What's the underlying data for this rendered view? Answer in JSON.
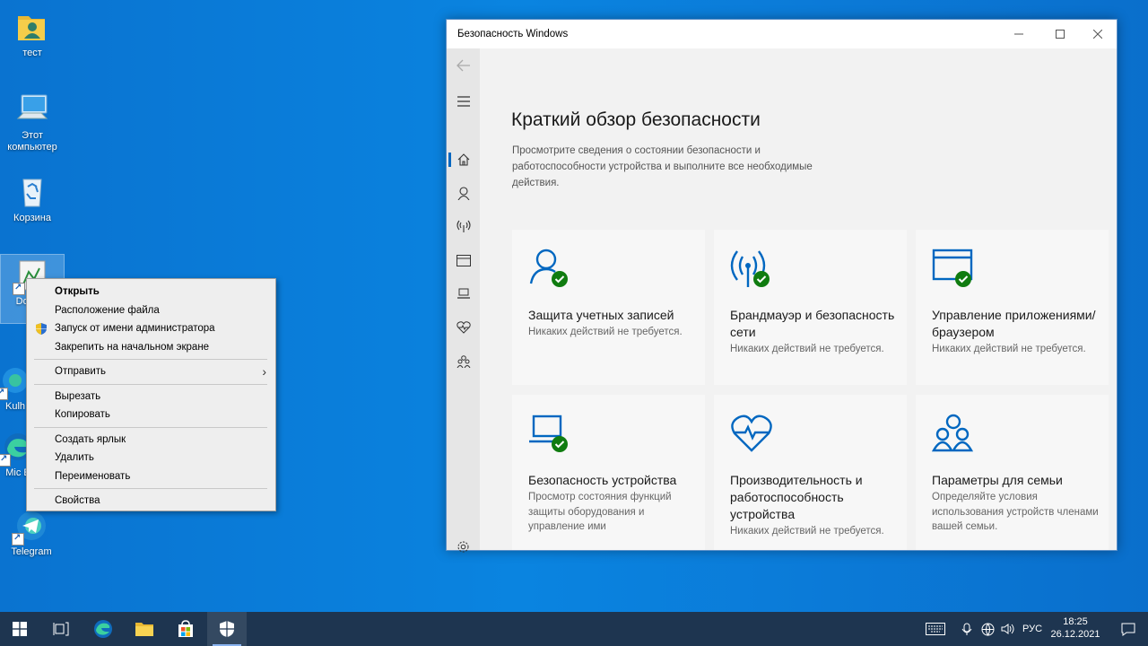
{
  "desktop": {
    "icons": [
      {
        "label": "тест"
      },
      {
        "label": "Этот компьютер"
      },
      {
        "label": "Корзина"
      },
      {
        "label": "Do Edg"
      },
      {
        "label": "Kulh"
      },
      {
        "label": "Mic E"
      },
      {
        "label": "Telegram"
      }
    ]
  },
  "context_menu": {
    "open": "Открыть",
    "file_location": "Расположение файла",
    "run_as_admin": "Запуск от имени администратора",
    "pin_start": "Закрепить на начальном экране",
    "send_to": "Отправить",
    "cut": "Вырезать",
    "copy": "Копировать",
    "create_shortcut": "Создать ярлык",
    "delete": "Удалить",
    "rename": "Переименовать",
    "properties": "Свойства"
  },
  "window": {
    "title": "Безопасность Windows",
    "heading": "Краткий обзор безопасности",
    "subtitle": "Просмотрите сведения о состоянии безопасности и работоспособности устройства и выполните все необходимые действия.",
    "cards": [
      {
        "title": "Защита учетных записей",
        "desc": "Никаких действий не требуется."
      },
      {
        "title": "Брандмауэр и безопасность сети",
        "desc": "Никаких действий не требуется."
      },
      {
        "title": "Управление приложениями/браузером",
        "desc": "Никаких действий не требуется."
      },
      {
        "title": "Безопасность устройства",
        "desc": "Просмотр состояния функций защиты оборудования и управление ими"
      },
      {
        "title": "Производительность и работоспособность устройства",
        "desc": "Никаких действий не требуется."
      },
      {
        "title": "Параметры для семьи",
        "desc": "Определяйте условия использования устройств членами вашей семьи."
      }
    ]
  },
  "taskbar": {
    "lang": "РУС",
    "time": "18:25",
    "date": "26.12.2021"
  },
  "colors": {
    "accent": "#0067c0",
    "ok_green": "#107c10",
    "desktop_blue": "#0a84e0",
    "taskbar": "#1e3550"
  }
}
